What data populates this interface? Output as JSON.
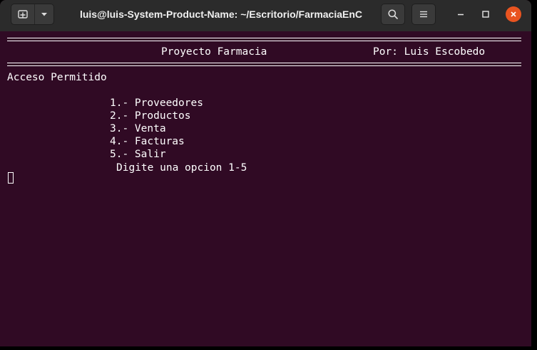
{
  "window": {
    "title": "luis@luis-System-Product-Name: ~/Escritorio/FarmaciaEnC"
  },
  "colors": {
    "terminal_bg": "#300a24",
    "titlebar_bg": "#2b2b2b",
    "close_button": "#e95420",
    "text": "#ffffff"
  },
  "icons": {
    "new_tab": "new-tab-icon",
    "dropdown": "chevron-down-icon",
    "search": "search-icon",
    "menu": "hamburger-menu-icon",
    "minimize": "minimize-icon",
    "maximize": "maximize-icon",
    "close": "close-icon"
  },
  "terminal": {
    "project_title": "Proyecto Farmacia",
    "author": "Por: Luis Escobedo",
    "access_message": "Acceso Permitido",
    "menu_items": [
      "1.- Proveedores",
      "2.- Productos",
      "3.- Venta",
      "4.- Facturas",
      "5.- Salir"
    ],
    "prompt": "Digite una opcion 1-5"
  }
}
